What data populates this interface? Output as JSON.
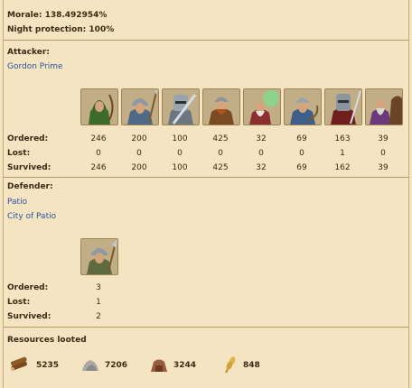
{
  "report": {
    "morale": "Morale: 138.492954%",
    "night_protection": "Night protection: 100%"
  },
  "attacker": {
    "heading": "Attacker:",
    "player": "Gordon Prime",
    "units": [
      {
        "icon": "archer-unit-icon",
        "ordered": "246",
        "lost": "0",
        "survived": "246"
      },
      {
        "icon": "spearman-unit-icon",
        "ordered": "200",
        "lost": "0",
        "survived": "200"
      },
      {
        "icon": "swordsman-unit-icon",
        "ordered": "100",
        "lost": "0",
        "survived": "100"
      },
      {
        "icon": "axeman-unit-icon",
        "ordered": "425",
        "lost": "0",
        "survived": "425"
      },
      {
        "icon": "scout-unit-icon",
        "ordered": "32",
        "lost": "0",
        "survived": "32"
      },
      {
        "icon": "light-cavalry-unit-icon",
        "ordered": "69",
        "lost": "0",
        "survived": "69"
      },
      {
        "icon": "heavy-cavalry-unit-icon",
        "ordered": "163",
        "lost": "1",
        "survived": "162"
      },
      {
        "icon": "noble-unit-icon",
        "ordered": "39",
        "lost": "0",
        "survived": "39"
      }
    ]
  },
  "defender": {
    "heading": "Defender:",
    "player": "Patio",
    "village": "City of Patio",
    "units": [
      {
        "icon": "spearman-unit-icon",
        "ordered": "3",
        "lost": "1",
        "survived": "2"
      }
    ]
  },
  "row_labels": {
    "ordered": "Ordered:",
    "lost": "Lost:",
    "survived": "Survived:"
  },
  "resources": {
    "heading": "Resources looted",
    "items": [
      {
        "icon": "wood-icon",
        "value": "5235"
      },
      {
        "icon": "stone-icon",
        "value": "7206"
      },
      {
        "icon": "iron-icon",
        "value": "3244"
      },
      {
        "icon": "grain-icon",
        "value": "848"
      }
    ]
  },
  "colors": {
    "background": "#f4e4c1",
    "link": "#2a55a0",
    "separator": "#b89a62"
  }
}
